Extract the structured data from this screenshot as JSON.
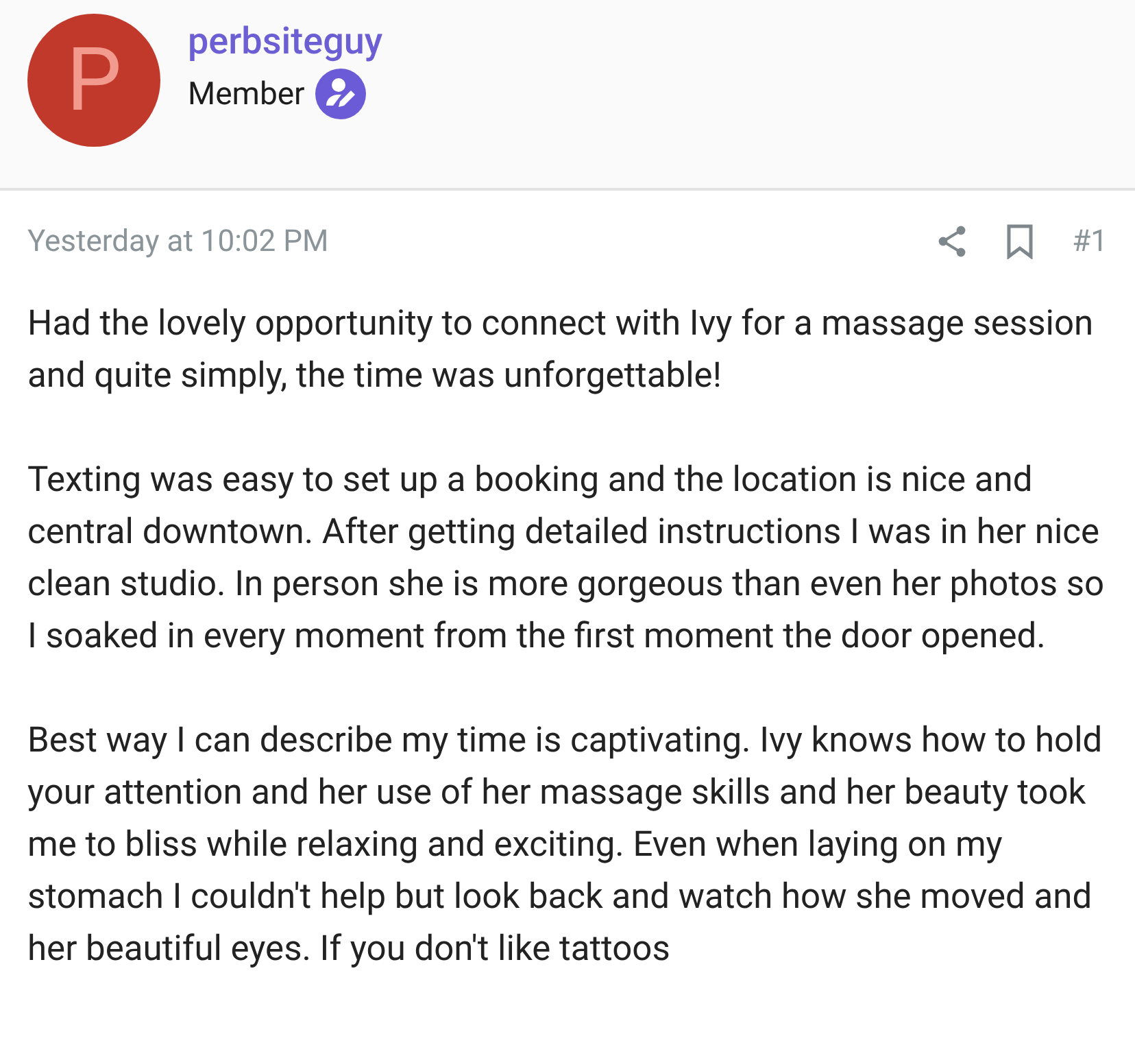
{
  "author": {
    "avatar_letter": "P",
    "username": "perbsiteguy",
    "role": "Member"
  },
  "post": {
    "timestamp": "Yesterday at 10:02 PM",
    "number": "#1",
    "paragraphs": [
      "Had the lovely opportunity to connect with Ivy for a massage session and quite simply, the time was unforgettable!",
      "Texting was easy to set up a booking and the location is nice and central downtown. After getting detailed instructions I was in her nice clean studio. In person she is more gorgeous than even her photos so I soaked in every moment from the first moment the door opened.",
      "Best way I can describe my time is captivating. Ivy knows how to hold your attention and her use of her massage skills and her beauty took me to bliss while relaxing and exciting. Even when laying on my stomach I couldn't help but look back and watch how she moved and her beautiful eyes. If you don't like tattoos"
    ]
  }
}
